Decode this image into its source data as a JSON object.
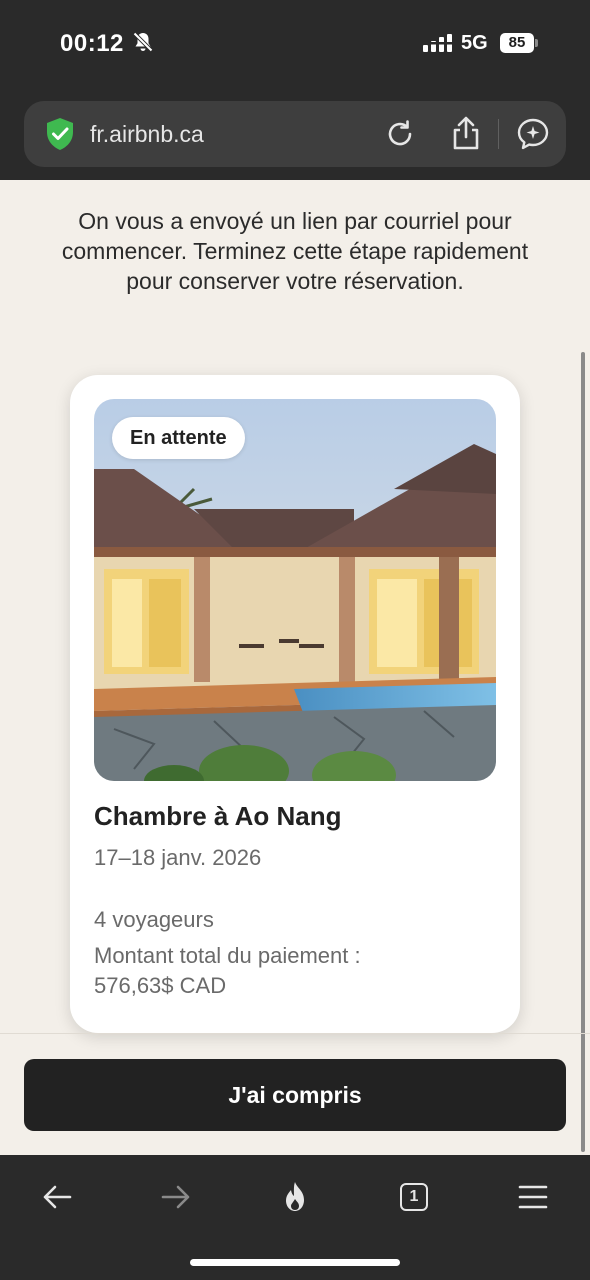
{
  "status_bar": {
    "time": "00:12",
    "network": "5G",
    "battery": "85"
  },
  "browser": {
    "url": "fr.airbnb.ca"
  },
  "page": {
    "intro_text": "On vous a envoyé un lien par courriel pour commencer. Terminez cette étape rapidement pour conserver votre réservation.",
    "card": {
      "badge": "En attente",
      "title": "Chambre à Ao Nang",
      "dates": "17–18 janv. 2026",
      "guests": "4 voyageurs",
      "total_label": "Montant total du paiement :",
      "total_amount": "576,63$ CAD"
    },
    "cta_label": "J'ai compris"
  },
  "toolbar": {
    "tabs_count": "1",
    "icons": [
      "back-arrow-icon",
      "forward-arrow-icon",
      "flame-icon",
      "tabs-icon",
      "menu-icon"
    ]
  },
  "colors": {
    "page_background": "#f3efe9",
    "chrome_background": "#2a2a2a",
    "cta_background": "#222222",
    "secure_green": "#3fb950"
  }
}
